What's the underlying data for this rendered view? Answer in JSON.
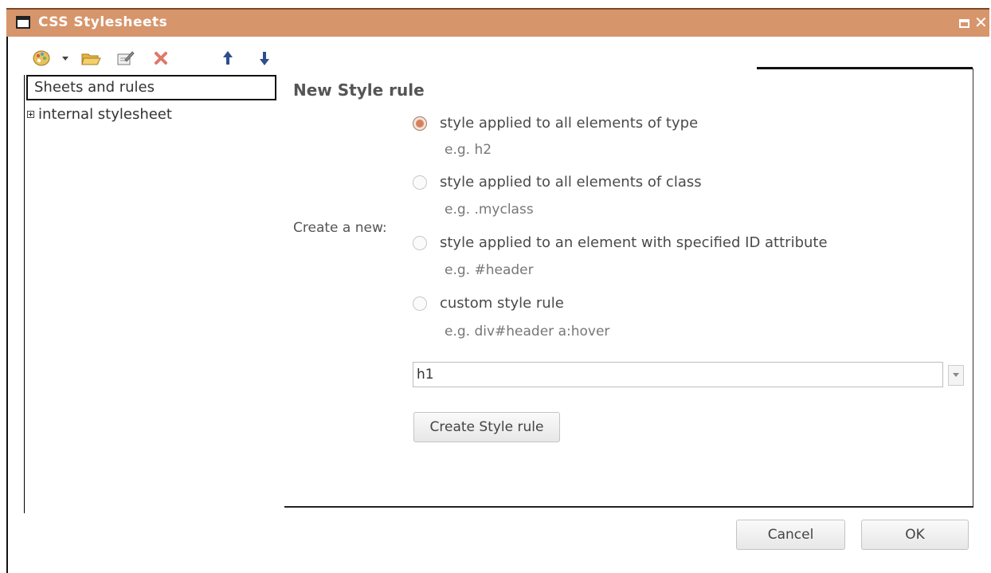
{
  "window": {
    "title": "CSS Stylesheets"
  },
  "toolbar": {
    "icons": [
      "palette-icon",
      "dropdown-arrow-icon",
      "folder-open-icon",
      "edit-icon",
      "delete-icon",
      "move-up-icon",
      "move-down-icon"
    ]
  },
  "tree": {
    "header": "Sheets and rules",
    "items": [
      {
        "label": "internal stylesheet"
      }
    ]
  },
  "panel": {
    "title": "New Style rule",
    "create_label": "Create a new:",
    "options": [
      {
        "label": "style applied to all elements of type",
        "example": "e.g. h2",
        "checked": true
      },
      {
        "label": "style applied to all elements of class",
        "example": "e.g. .myclass",
        "checked": false
      },
      {
        "label": "style applied to an element with specified ID attribute",
        "example": "e.g. #header",
        "checked": false
      },
      {
        "label": "custom style rule",
        "example": "e.g. div#header a:hover",
        "checked": false
      }
    ],
    "selector_value": "h1",
    "create_button": "Create Style rule"
  },
  "footer": {
    "cancel": "Cancel",
    "ok": "OK"
  },
  "colors": {
    "titlebar": "#d7956b",
    "radio_accent": "#d9805a"
  }
}
